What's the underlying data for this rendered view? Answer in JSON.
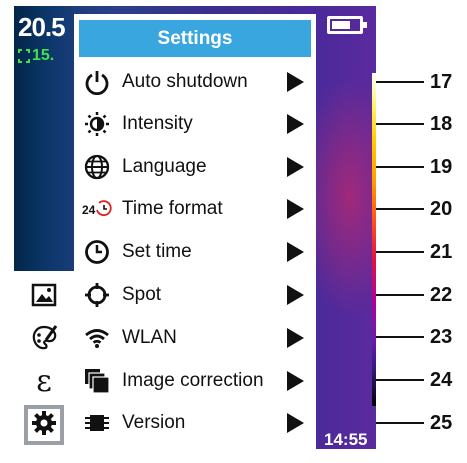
{
  "screen": {
    "temperature_main": "20.5",
    "temperature_spot": "15.",
    "clock": "14:55"
  },
  "settings": {
    "title": "Settings",
    "items": [
      {
        "label": "Auto shutdown",
        "icon": "power-icon"
      },
      {
        "label": "Intensity",
        "icon": "brightness-icon"
      },
      {
        "label": "Language",
        "icon": "globe-icon"
      },
      {
        "label": "Time format",
        "icon": "24h-clock-icon"
      },
      {
        "label": "Set time",
        "icon": "clock-icon"
      },
      {
        "label": "Spot",
        "icon": "crosshair-icon"
      },
      {
        "label": "WLAN",
        "icon": "wifi-icon"
      },
      {
        "label": "Image correction",
        "icon": "image-correction-icon"
      },
      {
        "label": "Version",
        "icon": "chip-icon"
      }
    ]
  },
  "toolbar": {
    "items": [
      {
        "icon": "gallery-icon"
      },
      {
        "icon": "palette-icon"
      },
      {
        "icon": "emissivity-icon",
        "glyph": "ε"
      },
      {
        "icon": "gear-icon",
        "active": true
      }
    ]
  },
  "scale": {
    "labels": [
      "17",
      "18",
      "19",
      "20",
      "21",
      "22",
      "23",
      "24",
      "25"
    ]
  },
  "colors": {
    "title_bar": "#3aa6e0",
    "spot_temperature": "#43e04b"
  }
}
